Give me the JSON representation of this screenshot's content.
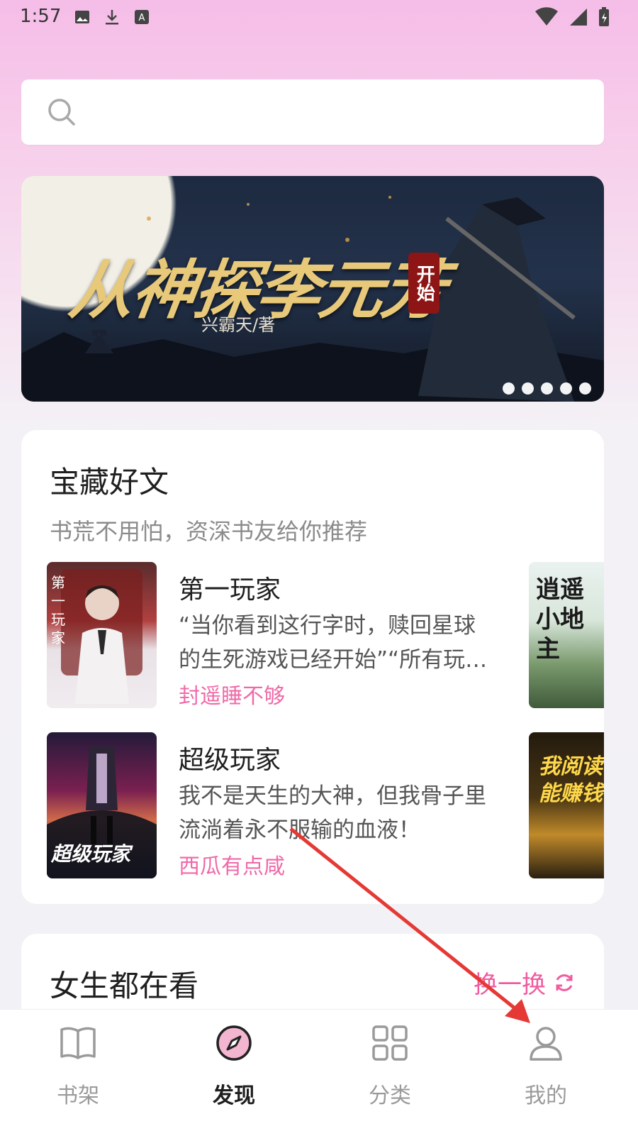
{
  "status": {
    "time": "1:57"
  },
  "search": {
    "placeholder": ""
  },
  "banner": {
    "title": "从神探李元芳",
    "seal": "开始",
    "author": "兴霸天/著",
    "page_count": 5
  },
  "treasure": {
    "title": "宝藏好文",
    "subtitle": "书荒不用怕，资深书友给你推荐",
    "books": [
      {
        "title": "第一玩家",
        "desc": "“当你看到这行字时，赎回星球的生死游戏已经开始”“所有玩…",
        "author": "封遥睡不够",
        "cover_text": "第一玩家"
      },
      {
        "title": "超级玩家",
        "desc": "我不是天生的大神，但我骨子里流淌着永不服输的血液！",
        "author": "西瓜有点咸",
        "cover_text": "超级玩家"
      }
    ],
    "side_covers": [
      "逍遥小地主",
      "我阅读能赚钱"
    ]
  },
  "girls": {
    "title": "女生都在看",
    "refresh": "换一换"
  },
  "tabs": [
    {
      "label": "书架",
      "icon": "book-icon"
    },
    {
      "label": "发现",
      "icon": "compass-icon"
    },
    {
      "label": "分类",
      "icon": "grid-icon"
    },
    {
      "label": "我的",
      "icon": "user-icon"
    }
  ],
  "colors": {
    "accent": "#f05ba0",
    "author": "#f06aa8",
    "arrow": "#e53935"
  }
}
